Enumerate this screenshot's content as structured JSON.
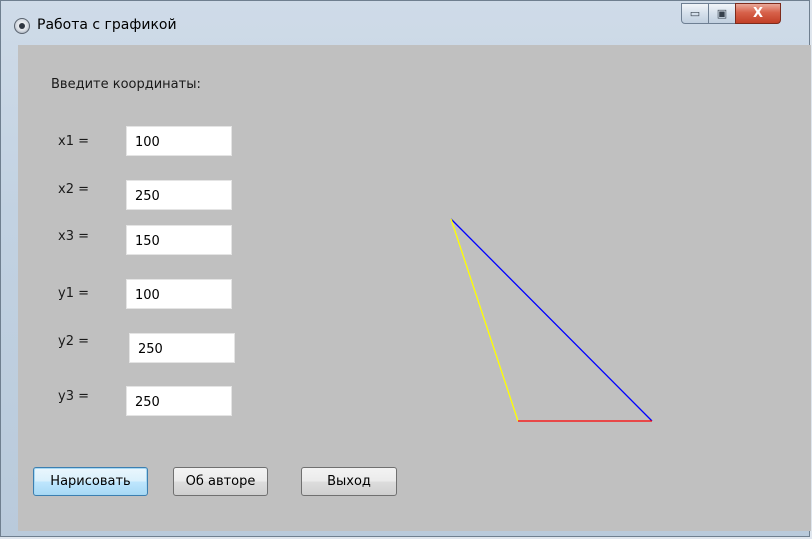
{
  "window": {
    "title": "Работа с графикой",
    "controls": {
      "minimize_glyph": "▭",
      "maximize_glyph": "▣",
      "close_glyph": "X"
    }
  },
  "form": {
    "prompt": "Введите координаты:",
    "fields": [
      {
        "label": "x1 =",
        "value": "100"
      },
      {
        "label": "x2 =",
        "value": "250"
      },
      {
        "label": "x3 =",
        "value": "150"
      },
      {
        "label": "y1 =",
        "value": "100"
      },
      {
        "label": "y2 =",
        "value": "250"
      },
      {
        "label": "y3 =",
        "value": "250"
      }
    ]
  },
  "buttons": {
    "draw": "Нарисовать",
    "about": "Об авторе",
    "exit": "Выход"
  },
  "drawing": {
    "segments": [
      {
        "name": "blue-line",
        "color": "#0000ff"
      },
      {
        "name": "yellow-line",
        "color": "#ffff00"
      },
      {
        "name": "red-line",
        "color": "#ff0000"
      }
    ]
  }
}
